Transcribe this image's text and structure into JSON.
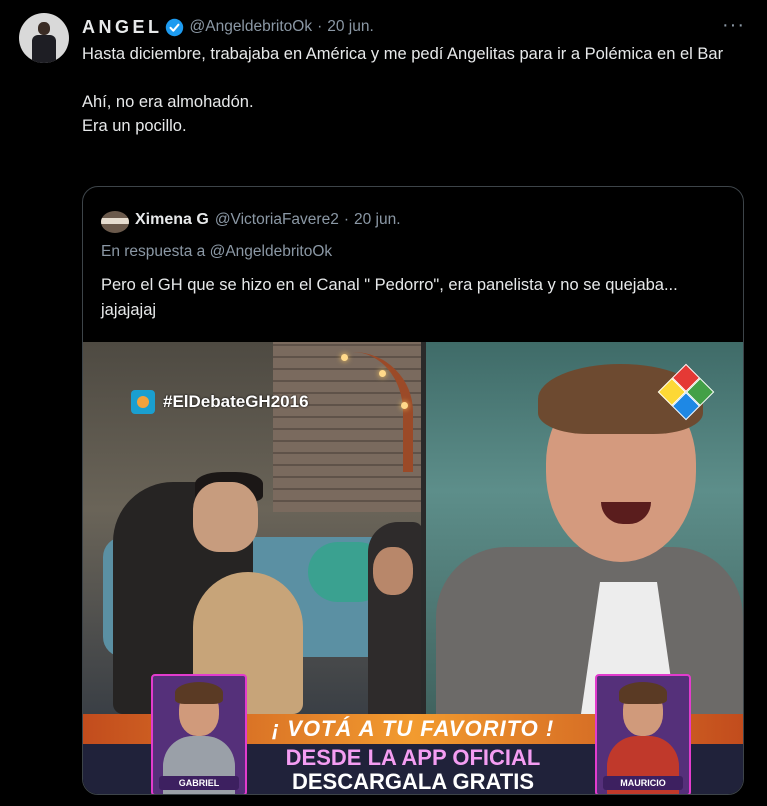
{
  "tweet": {
    "author_name": "ANGEL",
    "author_handle": "@AngeldebritoOk",
    "separator": "·",
    "date": "20 jun.",
    "more_label": "···",
    "text_line1": "Hasta diciembre, trabajaba en América y me pedí Angelitas para ir a Polémica en el Bar",
    "text_line2": "Ahí, no era almohadón.",
    "text_line3": "Era un pocillo."
  },
  "quoted": {
    "author_name": "Ximena G",
    "author_handle": "@VictoriaFavere2",
    "separator": "·",
    "date": "20 jun.",
    "reply_prefix": "En respuesta a",
    "reply_mention": "@AngeldebritoOk",
    "text": "Pero el GH que se hizo en el Canal \" Pedorro\", era panelista y no se quejaba... jajajajaj"
  },
  "media": {
    "hashtag": "#ElDebateGH2016",
    "banner_top": "¡ VOTÁ A TU FAVORITO !",
    "banner_line1": "DESDE LA APP OFICIAL",
    "banner_line2": "DESCARGALA GRATIS",
    "candidate_left": "GABRIEL",
    "candidate_right": "MAURICIO"
  },
  "colors": {
    "background": "#000000",
    "text": "#e7e9ea",
    "secondary": "#8b98a5",
    "verified": "#1d9bf0",
    "border": "#3d4449"
  },
  "icons": {
    "verified": "verified-badge-icon",
    "more": "more-icon"
  }
}
